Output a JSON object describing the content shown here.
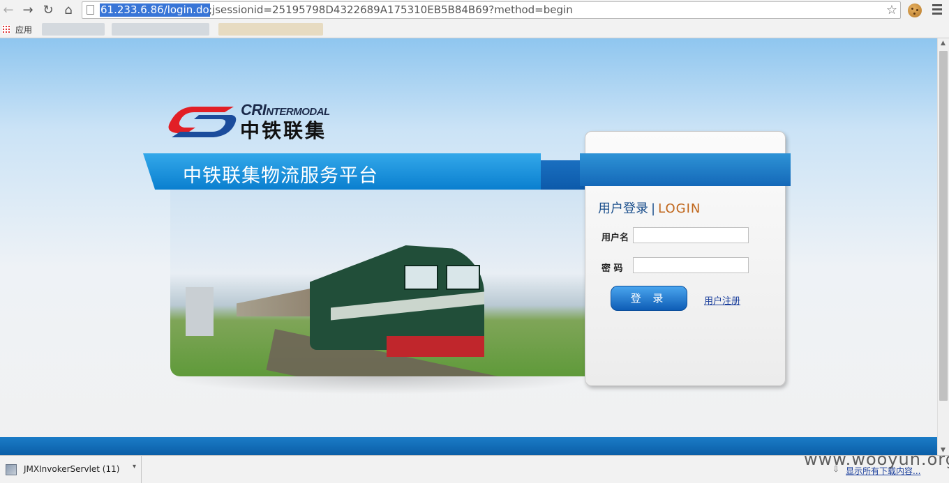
{
  "browser": {
    "url_host": "61.233.6.86/login.do",
    "url_rest": ";jsessionid=25195798D4322689A175310EB5B84B69?method=begin",
    "bookmarks_apps_label": "应用"
  },
  "page": {
    "logo_en_main": "CRI",
    "logo_en_sub": "NTERMODAL",
    "logo_cn": "中铁联集",
    "banner_title": "中铁联集物流服务平台",
    "login": {
      "heading_cn": "用户登录",
      "heading_sep": "|",
      "heading_en": "LOGIN",
      "username_label": "用户名",
      "password_label": "密 码",
      "username_value": "",
      "password_value": "",
      "login_button": "登 录",
      "register_link": "用户注册"
    }
  },
  "download_shelf": {
    "file_name": "JMXInvokerServlet (11)",
    "show_all": "显示所有下载内容..."
  },
  "watermark": "www.wooyun.org",
  "colors": {
    "banner": "#0a7fcf",
    "heading_en": "#c0661b",
    "heading_cn": "#1b4f8c"
  }
}
